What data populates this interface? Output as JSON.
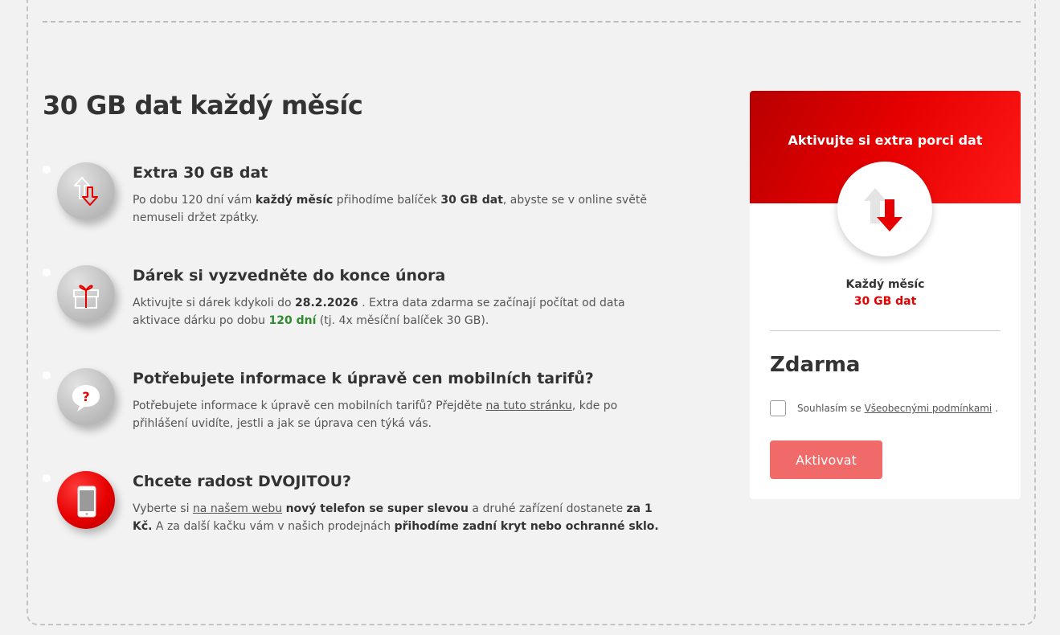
{
  "main": {
    "title": "30 GB dat každý měsíc"
  },
  "features": [
    {
      "title": "Extra 30 GB dat",
      "desc": [
        "Po dobu 120 dní vám ",
        "každý měsíc",
        " přihodíme balíček ",
        "30 GB dat",
        ", abyste se v online světě nemuseli držet zpátky."
      ]
    },
    {
      "title": "Dárek si vyzvedněte do konce února",
      "desc": [
        "Aktivujte si dárek kdykoli do ",
        "28.2.2026",
        " . Extra data zdarma se začínají počítat od data aktivace dárku po dobu ",
        "120 dní",
        " (tj. 4x měsíční balíček 30 GB)."
      ]
    },
    {
      "title": "Potřebujete informace k úpravě cen mobilních tarifů?",
      "desc": [
        "Potřebujete informace k úpravě cen mobilních tarifů? Přejděte ",
        "na tuto stránku",
        ", kde po přihlášení uvidíte, jestli a jak se úprava cen týká vás."
      ]
    },
    {
      "title": "Chcete radost DVOJITOU?",
      "desc": [
        "Vyberte si ",
        "na našem webu",
        " ",
        "nový telefon se super slevou",
        " a druhé zařízení dostanete ",
        "za 1 Kč.",
        " A za další kačku vám v našich prodejnách ",
        "přihodíme zadní kryt nebo ochranné sklo."
      ]
    }
  ],
  "card": {
    "header_title": "Aktivujte si extra porci dat",
    "label_line1": "Každý měsíc",
    "label_line2": "30 GB dat",
    "price": "Zdarma",
    "consent_text": "Souhlasím se",
    "consent_link": "Všeobecnými podmínkami",
    "consent_end": ".",
    "button_label": "Aktivovat"
  },
  "colors": {
    "brand_red": "#e60000",
    "button": "#f06a6a",
    "highlight_green": "#2e8b2e",
    "background": "#f2f2f2"
  },
  "icons": [
    "data-arrows-icon",
    "gift-icon",
    "question-bubble-icon",
    "smartphone-icon",
    "card-data-arrows-icon"
  ]
}
